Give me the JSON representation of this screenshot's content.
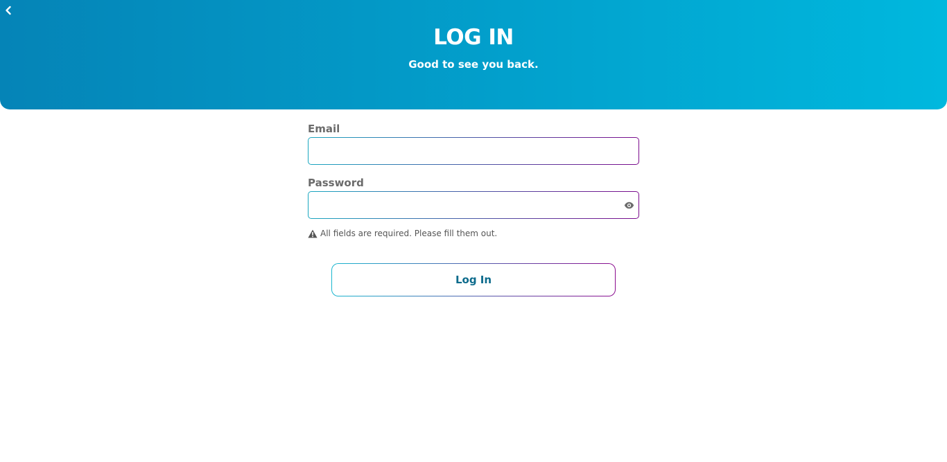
{
  "header": {
    "title": "LOG IN",
    "subtitle": "Good to see you back.",
    "back_icon": "chevron-left-icon"
  },
  "form": {
    "email": {
      "label": "Email",
      "value": "",
      "placeholder": ""
    },
    "password": {
      "label": "Password",
      "value": "",
      "placeholder": "",
      "toggle_icon": "eye-icon"
    },
    "validation": {
      "icon": "warning-icon",
      "message": "All fields are required. Please fill them out."
    },
    "submit_label": "Log In"
  },
  "colors": {
    "header_gradient_start": "#0584b7",
    "header_gradient_end": "#00b8de",
    "field_border_start": "#18a6c0",
    "field_border_end": "#7a0a8c",
    "button_text": "#0d6b8c",
    "label_text": "#6b6b6b"
  }
}
